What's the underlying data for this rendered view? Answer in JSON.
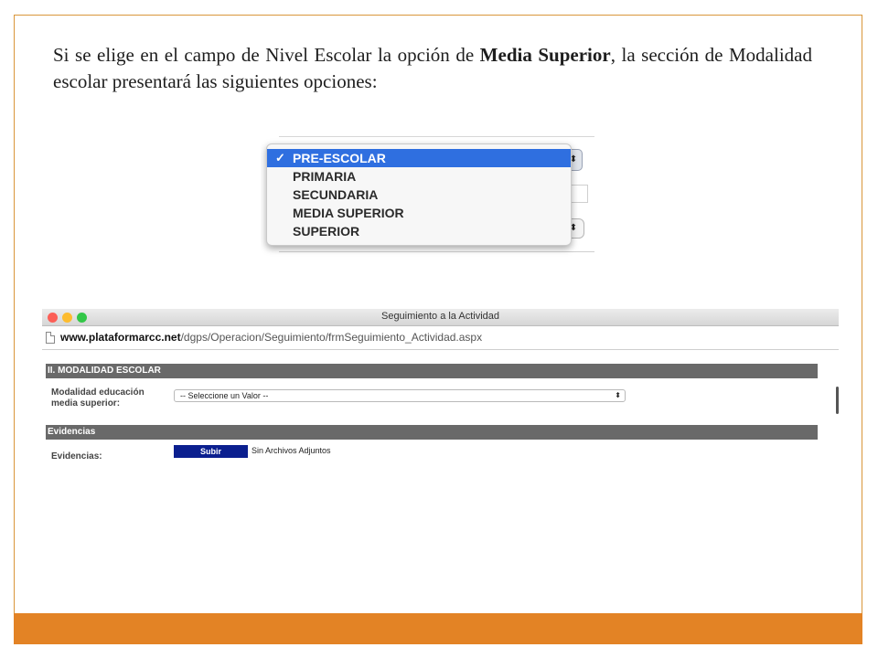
{
  "instruction": {
    "text_before": "Si se elige en el campo de Nivel Escolar la opción de ",
    "text_bold": "Media Superior",
    "text_after": ", la sección de Modalidad escolar presentará las siguientes opciones:"
  },
  "dropdown": {
    "options": [
      "PRE-ESCOLAR",
      "PRIMARIA",
      "SECUNDARIA",
      "MEDIA SUPERIOR",
      "SUPERIOR"
    ],
    "selected_index": 0,
    "check_glyph": "✓"
  },
  "browser": {
    "window_title": "Seguimiento a la Actividad",
    "url_domain": "www.plataformarcc.net",
    "url_path": "/dgps/Operacion/Seguimiento/frmSeguimiento_Actividad.aspx"
  },
  "form": {
    "section_modalidad": "II. MODALIDAD ESCOLAR",
    "modalidad_label": "Modalidad educación media superior:",
    "select_value": "-- Seleccione un Valor --",
    "section_evidencias": "Evidencias",
    "evidencias_label": "Evidencias:",
    "upload_label": "Subir",
    "no_files_text": "Sin Archivos Adjuntos"
  },
  "colors": {
    "accent_orange": "#e38325",
    "selected_option_blue": "#2f6fe0",
    "upload_button_blue": "#0b1f8f",
    "section_header_gray": "#696969"
  },
  "icons": [
    "checkmark-icon",
    "document-icon",
    "select-arrows-icon"
  ]
}
